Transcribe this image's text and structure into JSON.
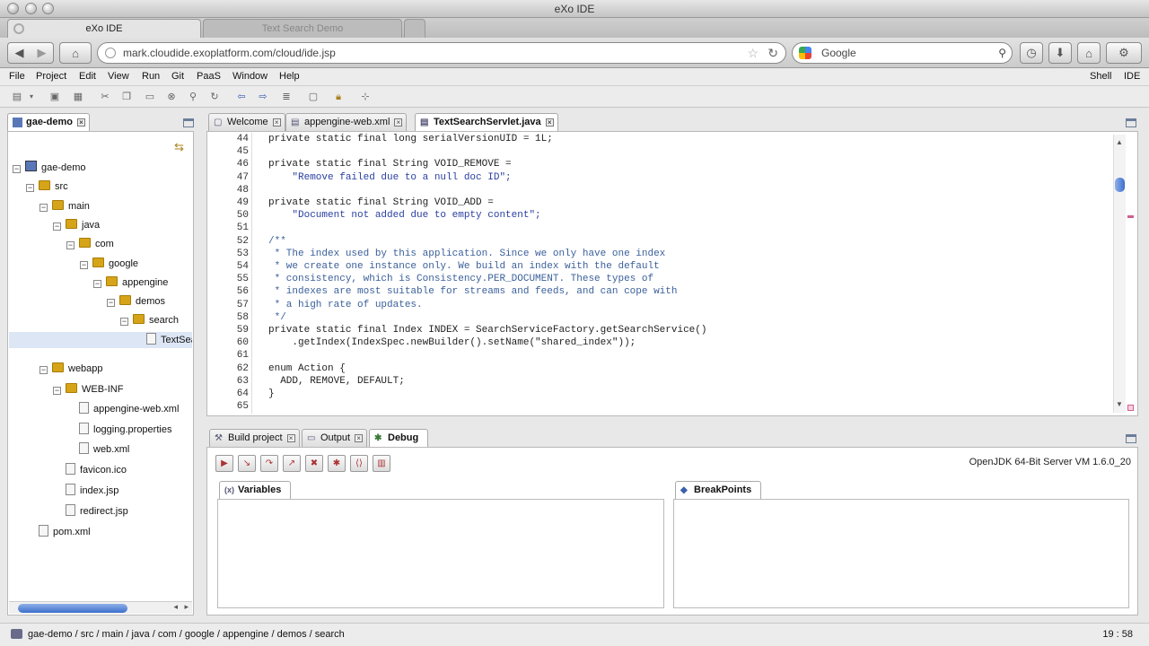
{
  "window": {
    "title": "eXo IDE"
  },
  "browser_tabs": [
    {
      "label": "eXo IDE",
      "active": true
    },
    {
      "label": "Text Search Demo",
      "active": false
    }
  ],
  "nav": {
    "url": "mark.cloudide.exoplatform.com/cloud/ide.jsp",
    "search_placeholder": "Google"
  },
  "menu": {
    "items": [
      "File",
      "Project",
      "Edit",
      "View",
      "Run",
      "Git",
      "PaaS",
      "Window",
      "Help"
    ],
    "right": [
      "Shell",
      "IDE"
    ]
  },
  "project_panel": {
    "tab": "gae-demo",
    "tree": [
      {
        "label": "gae-demo",
        "kind": "project",
        "level": 0,
        "exp": "−"
      },
      {
        "label": "src",
        "kind": "folder",
        "level": 1,
        "exp": "−"
      },
      {
        "label": "main",
        "kind": "folder",
        "level": 2,
        "exp": "−"
      },
      {
        "label": "java",
        "kind": "folder",
        "level": 3,
        "exp": "−"
      },
      {
        "label": "com",
        "kind": "folder",
        "level": 4,
        "exp": "−"
      },
      {
        "label": "google",
        "kind": "folder",
        "level": 5,
        "exp": "−"
      },
      {
        "label": "appengine",
        "kind": "folder",
        "level": 6,
        "exp": "−"
      },
      {
        "label": "demos",
        "kind": "folder",
        "level": 7,
        "exp": "−"
      },
      {
        "label": "search",
        "kind": "folder",
        "level": 8,
        "exp": "−"
      },
      {
        "label": "TextSearchServlet.java",
        "kind": "file",
        "level": 9,
        "exp": "",
        "selected": true
      },
      {
        "label": "webapp",
        "kind": "folder",
        "level": 2,
        "exp": "−"
      },
      {
        "label": "WEB-INF",
        "kind": "folder",
        "level": 3,
        "exp": "−"
      },
      {
        "label": "appengine-web.xml",
        "kind": "file",
        "level": 4,
        "exp": ""
      },
      {
        "label": "logging.properties",
        "kind": "file",
        "level": 4,
        "exp": ""
      },
      {
        "label": "web.xml",
        "kind": "file",
        "level": 4,
        "exp": ""
      },
      {
        "label": "favicon.ico",
        "kind": "file",
        "level": 3,
        "exp": ""
      },
      {
        "label": "index.jsp",
        "kind": "file",
        "level": 3,
        "exp": ""
      },
      {
        "label": "redirect.jsp",
        "kind": "file",
        "level": 3,
        "exp": ""
      },
      {
        "label": "pom.xml",
        "kind": "file",
        "level": 1,
        "exp": ""
      }
    ]
  },
  "editor": {
    "tabs": [
      {
        "label": "Welcome",
        "active": false
      },
      {
        "label": "appengine-web.xml",
        "active": false
      },
      {
        "label": "TextSearchServlet.java",
        "active": true
      }
    ],
    "lines": [
      {
        "n": "44",
        "text": "private static final long serialVersionUID = 1L;",
        "cls": ""
      },
      {
        "n": "45",
        "text": "",
        "cls": ""
      },
      {
        "n": "46",
        "text": "private static final String VOID_REMOVE =",
        "cls": ""
      },
      {
        "n": "47",
        "text": "    \"Remove failed due to a null doc ID\";",
        "cls": "str"
      },
      {
        "n": "48",
        "text": "",
        "cls": ""
      },
      {
        "n": "49",
        "text": "private static final String VOID_ADD =",
        "cls": ""
      },
      {
        "n": "50",
        "text": "    \"Document not added due to empty content\";",
        "cls": "str"
      },
      {
        "n": "51",
        "text": "",
        "cls": ""
      },
      {
        "n": "52",
        "text": "/**",
        "cls": "cmt"
      },
      {
        "n": "53",
        "text": " * The index used by this application. Since we only have one index",
        "cls": "cmt"
      },
      {
        "n": "54",
        "text": " * we create one instance only. We build an index with the default",
        "cls": "cmt"
      },
      {
        "n": "55",
        "text": " * consistency, which is Consistency.PER_DOCUMENT. These types of",
        "cls": "cmt"
      },
      {
        "n": "56",
        "text": " * indexes are most suitable for streams and feeds, and can cope with",
        "cls": "cmt"
      },
      {
        "n": "57",
        "text": " * a high rate of updates.",
        "cls": "cmt"
      },
      {
        "n": "58",
        "text": " */",
        "cls": "cmt"
      },
      {
        "n": "59",
        "text": "private static final Index INDEX = SearchServiceFactory.getSearchService()",
        "cls": ""
      },
      {
        "n": "60",
        "text": "    .getIndex(IndexSpec.newBuilder().setName(\"shared_index\"));",
        "cls": ""
      },
      {
        "n": "61",
        "text": "",
        "cls": ""
      },
      {
        "n": "62",
        "text": "enum Action {",
        "cls": ""
      },
      {
        "n": "63",
        "text": "  ADD, REMOVE, DEFAULT;",
        "cls": ""
      },
      {
        "n": "64",
        "text": "}",
        "cls": ""
      },
      {
        "n": "65",
        "text": "",
        "cls": ""
      }
    ]
  },
  "bottom_panel": {
    "tabs": [
      {
        "label": "Build project",
        "active": false
      },
      {
        "label": "Output",
        "active": false
      },
      {
        "label": "Debug",
        "active": true
      }
    ],
    "vm_label": "OpenJDK 64-Bit Server VM 1.6.0_20",
    "variables_label": "Variables",
    "breakpoints_label": "BreakPoints"
  },
  "status": {
    "path": "gae-demo / src / main / java / com / google / appengine / demos / search",
    "position": "19 : 58"
  }
}
